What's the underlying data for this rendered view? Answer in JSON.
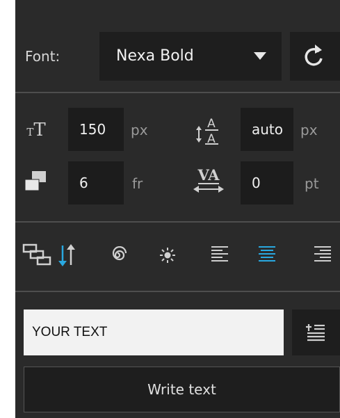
{
  "font_row": {
    "label": "Font:",
    "selected_font": "Nexa Bold",
    "reset_icon": "refresh-icon"
  },
  "metrics": {
    "font_size": {
      "icon": "font-size-icon",
      "value": "150",
      "unit": "px"
    },
    "line_height": {
      "icon": "line-height-icon",
      "value": "auto",
      "unit": "px"
    },
    "frames": {
      "icon": "layers-icon",
      "value": "6",
      "unit": "fr"
    },
    "tracking": {
      "icon": "tracking-icon",
      "icon_text": "VA",
      "value": "0",
      "unit": "pt"
    }
  },
  "toolbar": {
    "icons": [
      "stack-order-icon",
      "sort-arrows-icon",
      "spiral-icon",
      "sun-icon",
      "align-left-icon",
      "align-center-icon",
      "align-right-icon"
    ],
    "active_color": "#29a8e0"
  },
  "text_input": {
    "value": "YOUR TEXT"
  },
  "write_button": {
    "label": "Write text"
  }
}
